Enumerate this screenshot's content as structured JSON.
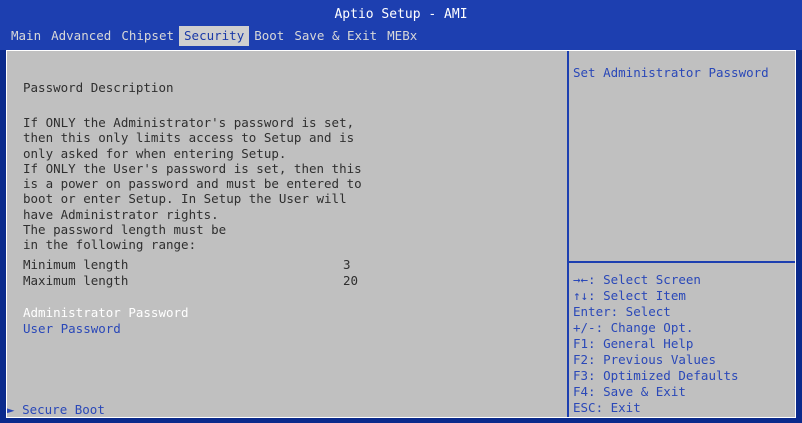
{
  "window": {
    "title": "Aptio Setup - AMI"
  },
  "tabs": [
    "Main",
    "Advanced",
    "Chipset",
    "Security",
    "Boot",
    "Save & Exit",
    "MEBx"
  ],
  "active_tab": "Security",
  "main": {
    "section_title": "Password Description",
    "description": [
      "If ONLY the Administrator's password is set,",
      "then this only limits access to Setup and is",
      "only asked for when entering Setup.",
      "If ONLY the User's password is set, then this",
      "is a power on password and must be entered to",
      "boot or enter Setup. In Setup the User will",
      "have Administrator rights.",
      "The password length must be",
      "in the following range:"
    ],
    "min_label": "Minimum length",
    "min_value": "3",
    "max_label": "Maximum length",
    "max_value": "20",
    "admin_password": "Administrator Password",
    "user_password": "User Password",
    "secure_boot": "Secure Boot",
    "arrow": "►"
  },
  "help": {
    "description": "Set Administrator Password",
    "keys": [
      "→←: Select Screen",
      "↑↓: Select Item",
      "Enter: Select",
      "+/-: Change Opt.",
      "F1: General Help",
      "F2: Previous Values",
      "F3: Optimized Defaults",
      "F4: Save & Exit",
      "ESC: Exit"
    ]
  },
  "colors": {
    "header_bg": "#1d3fb0",
    "panel_bg": "#c0c0c0",
    "accent_text": "#2a48b8",
    "selected_text": "#ffffff"
  }
}
